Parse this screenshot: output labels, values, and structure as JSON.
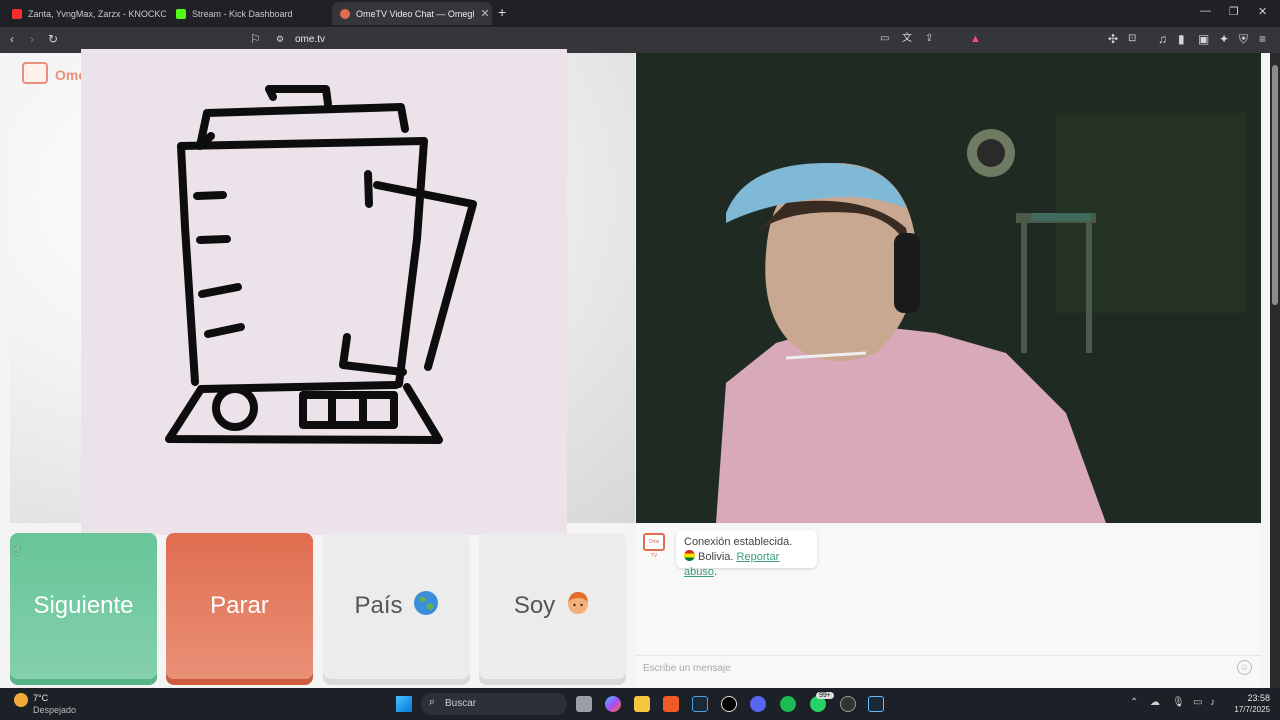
{
  "browser": {
    "tabs": [
      {
        "label": "Zanta, YvngMax, Zarzx - KNOCKOUT",
        "icon": "youtube-icon"
      },
      {
        "label": "Stream - Kick Dashboard",
        "icon": "kick-icon"
      },
      {
        "label": "OmeTV Video Chat — Omegl",
        "icon": "ometv-icon",
        "active": true
      }
    ],
    "url": "ome.tv"
  },
  "page": {
    "logo_text": "Ome",
    "buttons": {
      "next": "Siguiente",
      "stop": "Parar",
      "country": "País",
      "me": "Soy"
    },
    "chat": {
      "logo_text": "Ome TV",
      "status": "Conexión establecida.",
      "country": "Bolivia.",
      "report_link": "Reportar abuso",
      "report_suffix": ".",
      "input_placeholder": "Escribe un mensaje"
    }
  },
  "taskbar": {
    "weather_temp": "7°C",
    "weather_desc": "Despejado",
    "search_label": "Buscar",
    "badge": "99+",
    "time": "23:58",
    "date": "17/7/2025"
  },
  "colors": {
    "accent_green": "#67c597",
    "accent_red": "#e06d4f",
    "link": "#3b9b84"
  }
}
